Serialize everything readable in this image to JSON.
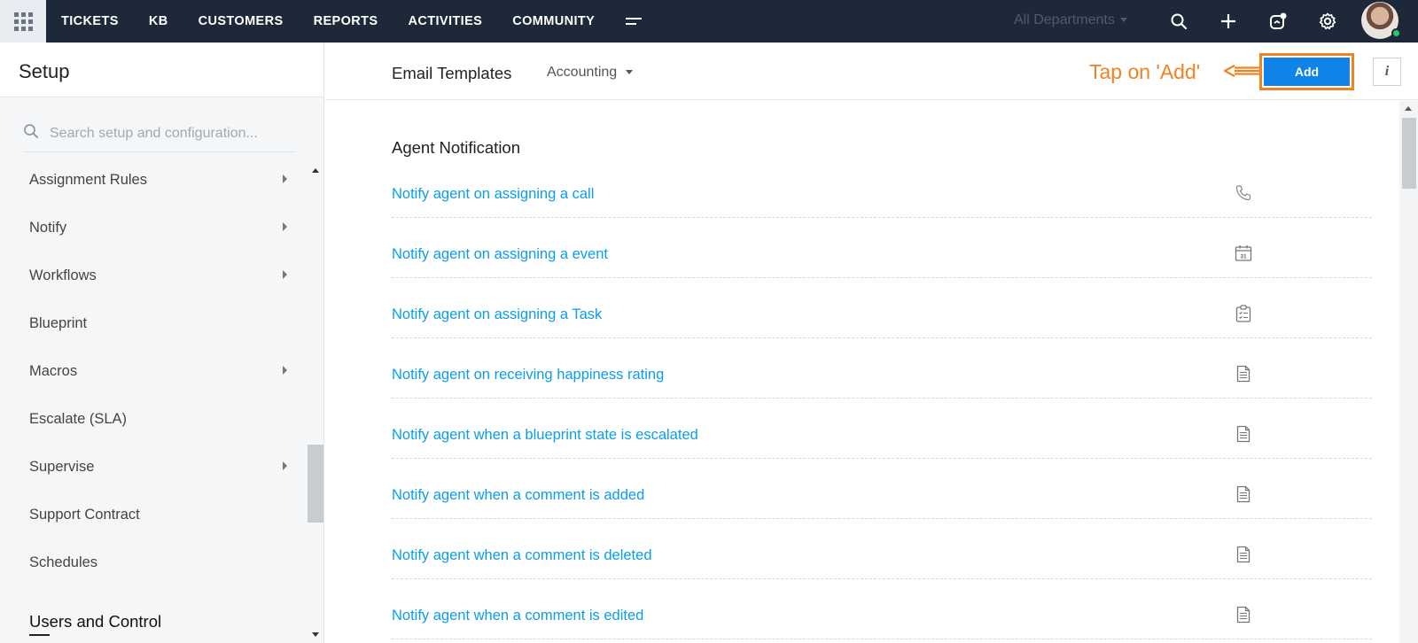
{
  "topbar": {
    "apps_icon": "apps-grid-icon",
    "nav": [
      {
        "label": "TICKETS"
      },
      {
        "label": "KB"
      },
      {
        "label": "CUSTOMERS"
      },
      {
        "label": "REPORTS"
      },
      {
        "label": "ACTIVITIES"
      },
      {
        "label": "COMMUNITY"
      }
    ],
    "more_icon": "more-menu-icon",
    "department": "All Departments",
    "icons": [
      "search-icon",
      "plus-icon",
      "notification-icon",
      "gear-icon"
    ],
    "avatar_status_color": "#28c76f"
  },
  "sidebar": {
    "title": "Setup",
    "search_placeholder": "Search setup and configuration...",
    "items": [
      {
        "label": "Assignment Rules",
        "has_submenu": true
      },
      {
        "label": "Notify",
        "has_submenu": true
      },
      {
        "label": "Workflows",
        "has_submenu": true
      },
      {
        "label": "Blueprint",
        "has_submenu": false
      },
      {
        "label": "Macros",
        "has_submenu": true
      },
      {
        "label": "Escalate (SLA)",
        "has_submenu": false
      },
      {
        "label": "Supervise",
        "has_submenu": true
      },
      {
        "label": "Support Contract",
        "has_submenu": false
      },
      {
        "label": "Schedules",
        "has_submenu": false
      }
    ],
    "section": "Users and Control"
  },
  "header": {
    "title": "Email Templates",
    "department": "Accounting",
    "annotation": "Tap on 'Add'",
    "add_label": "Add",
    "info_label": "i",
    "accent_color": "#0f83e8",
    "annotation_color": "#f08321"
  },
  "content": {
    "section_title": "Agent Notification",
    "link_color": "#0b9de9",
    "templates": [
      {
        "label": "Notify agent on assigning a call",
        "icon": "phone-icon"
      },
      {
        "label": "Notify agent on assigning a event",
        "icon": "calendar-icon"
      },
      {
        "label": "Notify agent on assigning a Task",
        "icon": "clipboard-icon"
      },
      {
        "label": "Notify agent on receiving happiness rating",
        "icon": "document-icon"
      },
      {
        "label": "Notify agent when a blueprint state is escalated",
        "icon": "document-icon"
      },
      {
        "label": "Notify agent when a comment is added",
        "icon": "document-icon"
      },
      {
        "label": "Notify agent when a comment is deleted",
        "icon": "document-icon"
      },
      {
        "label": "Notify agent when a comment is edited",
        "icon": "document-icon"
      }
    ],
    "calendar_day": "31"
  }
}
